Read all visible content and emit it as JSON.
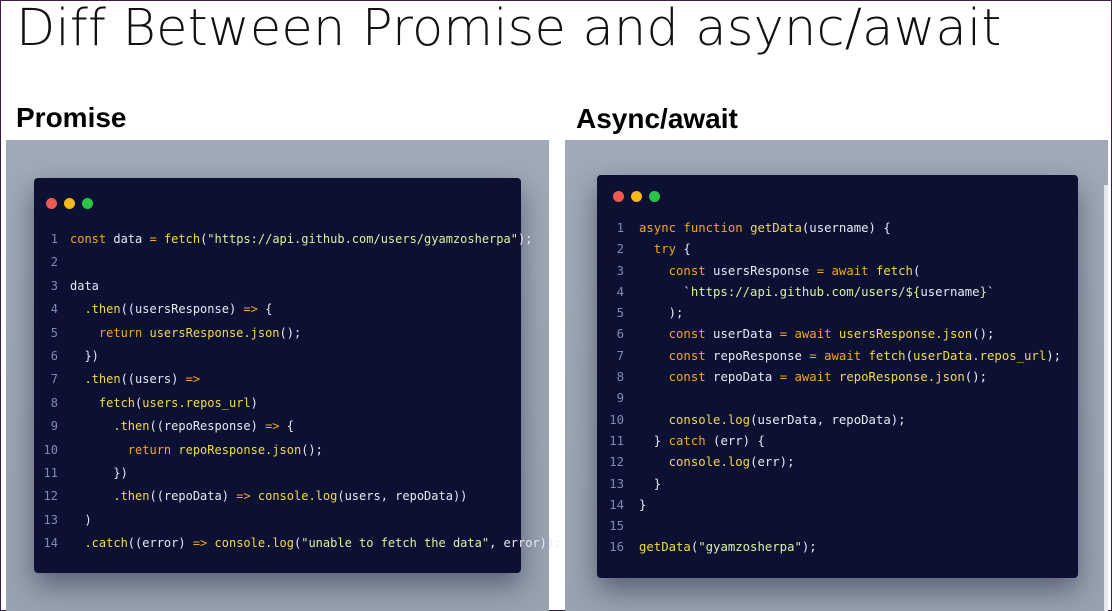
{
  "title": "Diff Between Promise and async/await",
  "left": {
    "heading": "Promise",
    "lines": [
      {
        "n": "1",
        "t": [
          [
            "const ",
            "k"
          ],
          [
            "data ",
            "p"
          ],
          [
            "= ",
            "k"
          ],
          [
            "fetch",
            "f"
          ],
          [
            "(",
            "p"
          ],
          [
            "\"https://api.github.com/users/gyamzosherpa\"",
            "s"
          ],
          [
            ");",
            "p"
          ]
        ]
      },
      {
        "n": "2",
        "t": []
      },
      {
        "n": "3",
        "t": [
          [
            "data",
            "p"
          ]
        ]
      },
      {
        "n": "4",
        "t": [
          [
            "  .then",
            "f"
          ],
          [
            "((usersResponse) ",
            "p"
          ],
          [
            "=> ",
            "k"
          ],
          [
            "{",
            "p"
          ]
        ]
      },
      {
        "n": "5",
        "t": [
          [
            "    return ",
            "k"
          ],
          [
            "usersResponse",
            "f"
          ],
          [
            ".json",
            "f"
          ],
          [
            "();",
            "p"
          ]
        ]
      },
      {
        "n": "6",
        "t": [
          [
            "  })",
            "p"
          ]
        ]
      },
      {
        "n": "7",
        "t": [
          [
            "  .then",
            "f"
          ],
          [
            "((users) ",
            "p"
          ],
          [
            "=>",
            "k"
          ]
        ]
      },
      {
        "n": "8",
        "t": [
          [
            "    fetch",
            "f"
          ],
          [
            "(",
            "p"
          ],
          [
            "users",
            "f"
          ],
          [
            ".repos_url",
            "f"
          ],
          [
            ")",
            "p"
          ]
        ]
      },
      {
        "n": "9",
        "t": [
          [
            "      .then",
            "f"
          ],
          [
            "((repoResponse) ",
            "p"
          ],
          [
            "=> ",
            "k"
          ],
          [
            "{",
            "p"
          ]
        ]
      },
      {
        "n": "10",
        "t": [
          [
            "        return ",
            "k"
          ],
          [
            "repoResponse",
            "f"
          ],
          [
            ".json",
            "f"
          ],
          [
            "();",
            "p"
          ]
        ]
      },
      {
        "n": "11",
        "t": [
          [
            "      })",
            "p"
          ]
        ]
      },
      {
        "n": "12",
        "t": [
          [
            "      .then",
            "f"
          ],
          [
            "((repoData) ",
            "p"
          ],
          [
            "=> ",
            "k"
          ],
          [
            "console",
            "f"
          ],
          [
            ".log",
            "f"
          ],
          [
            "(users, repoData))",
            "p"
          ]
        ]
      },
      {
        "n": "13",
        "t": [
          [
            "  )",
            "p"
          ]
        ]
      },
      {
        "n": "14",
        "t": [
          [
            "  .catch",
            "f"
          ],
          [
            "((error) ",
            "p"
          ],
          [
            "=> ",
            "k"
          ],
          [
            "console",
            "f"
          ],
          [
            ".log",
            "f"
          ],
          [
            "(",
            "p"
          ],
          [
            "\"unable to fetch the data\"",
            "s"
          ],
          [
            ", error));",
            "p"
          ]
        ]
      }
    ]
  },
  "right": {
    "heading": "Async/await",
    "lines": [
      {
        "n": "1",
        "t": [
          [
            "async ",
            "k"
          ],
          [
            "function ",
            "k"
          ],
          [
            "getData",
            "f"
          ],
          [
            "(username) {",
            "p"
          ]
        ]
      },
      {
        "n": "2",
        "t": [
          [
            "  try ",
            "k"
          ],
          [
            "{",
            "p"
          ]
        ]
      },
      {
        "n": "3",
        "t": [
          [
            "    const ",
            "k"
          ],
          [
            "usersResponse ",
            "p"
          ],
          [
            "= ",
            "k"
          ],
          [
            "await ",
            "k"
          ],
          [
            "fetch",
            "f"
          ],
          [
            "(",
            "p"
          ]
        ]
      },
      {
        "n": "4",
        "t": [
          [
            "      `https://api.github.com/users/${",
            "s"
          ],
          [
            "username",
            "p"
          ],
          [
            "}`",
            "s"
          ]
        ]
      },
      {
        "n": "5",
        "t": [
          [
            "    );",
            "p"
          ]
        ]
      },
      {
        "n": "6",
        "t": [
          [
            "    const ",
            "k"
          ],
          [
            "userData ",
            "p"
          ],
          [
            "= ",
            "k"
          ],
          [
            "await ",
            "k"
          ],
          [
            "usersResponse",
            "f"
          ],
          [
            ".json",
            "f"
          ],
          [
            "();",
            "p"
          ]
        ]
      },
      {
        "n": "7",
        "t": [
          [
            "    const ",
            "k"
          ],
          [
            "repoResponse ",
            "p"
          ],
          [
            "= ",
            "k"
          ],
          [
            "await ",
            "k"
          ],
          [
            "fetch",
            "f"
          ],
          [
            "(",
            "p"
          ],
          [
            "userData",
            "f"
          ],
          [
            ".repos_url",
            "f"
          ],
          [
            ");",
            "p"
          ]
        ]
      },
      {
        "n": "8",
        "t": [
          [
            "    const ",
            "k"
          ],
          [
            "repoData ",
            "p"
          ],
          [
            "= ",
            "k"
          ],
          [
            "await ",
            "k"
          ],
          [
            "repoResponse",
            "f"
          ],
          [
            ".json",
            "f"
          ],
          [
            "();",
            "p"
          ]
        ]
      },
      {
        "n": "9",
        "t": []
      },
      {
        "n": "10",
        "t": [
          [
            "    console",
            "f"
          ],
          [
            ".log",
            "f"
          ],
          [
            "(userData, repoData);",
            "p"
          ]
        ]
      },
      {
        "n": "11",
        "t": [
          [
            "  } ",
            "p"
          ],
          [
            "catch ",
            "k"
          ],
          [
            "(err) {",
            "p"
          ]
        ]
      },
      {
        "n": "12",
        "t": [
          [
            "    console",
            "f"
          ],
          [
            ".log",
            "f"
          ],
          [
            "(err);",
            "p"
          ]
        ]
      },
      {
        "n": "13",
        "t": [
          [
            "  }",
            "p"
          ]
        ]
      },
      {
        "n": "14",
        "t": [
          [
            "}",
            "p"
          ]
        ]
      },
      {
        "n": "15",
        "t": []
      },
      {
        "n": "16",
        "t": [
          [
            "getData",
            "f"
          ],
          [
            "(",
            "p"
          ],
          [
            "\"gyamzosherpa\"",
            "s"
          ],
          [
            ");",
            "p"
          ]
        ]
      }
    ]
  }
}
